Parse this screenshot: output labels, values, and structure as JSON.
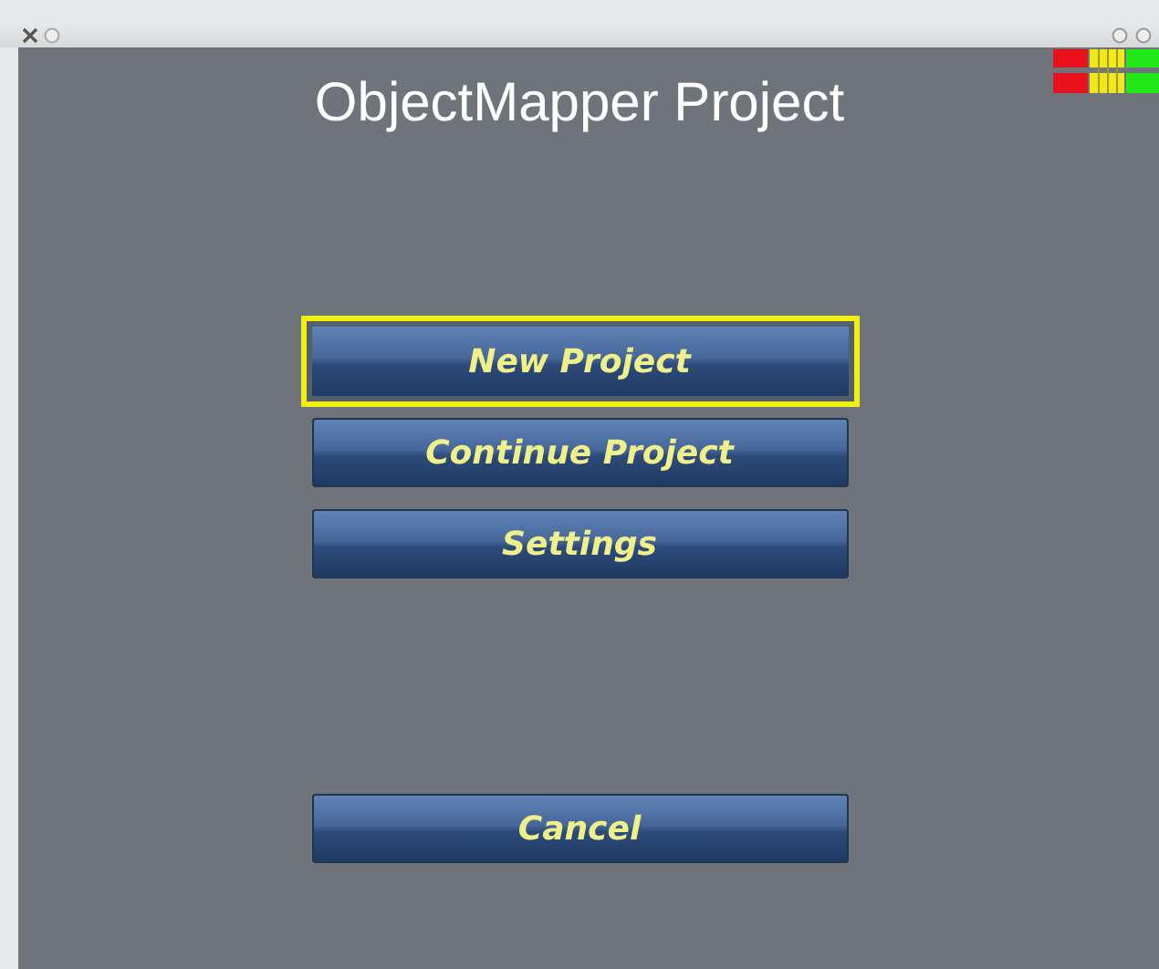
{
  "window": {
    "title": "ObjectMapper Project"
  },
  "menu_buttons": [
    {
      "label": "New Project",
      "focused": true
    },
    {
      "label": "Continue Project",
      "focused": false
    },
    {
      "label": "Settings",
      "focused": false
    }
  ],
  "cancel_button": {
    "label": "Cancel",
    "focused": false
  }
}
